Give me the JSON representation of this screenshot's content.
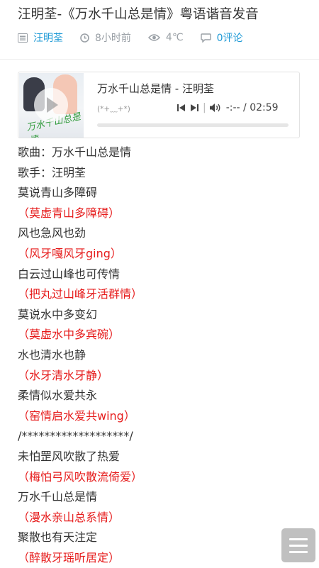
{
  "article": {
    "title": "汪明荃-《万水千山总是情》粤语谐音发音"
  },
  "meta": {
    "author": "汪明荃",
    "time": "8小时前",
    "temperature": "4℃",
    "comments": "0评论",
    "colors": {
      "link": "#1e9ad6",
      "muted": "#9aa0a6"
    }
  },
  "player": {
    "title": "万水千山总是情 - 汪明荃",
    "subtitle": "(*+﹏+*)",
    "time": "-:-- / 02:59",
    "cover_text": "万水千山总是情",
    "icons": [
      "play-icon",
      "previous-icon",
      "next-icon",
      "volume-icon"
    ]
  },
  "lyrics": [
    {
      "text": "歌曲：万水千山总是情",
      "style": "black"
    },
    {
      "text": "歌手：汪明荃",
      "style": "black"
    },
    {
      "text": "莫说青山多障碍",
      "style": "black"
    },
    {
      "text": "（莫虚青山多障碍）",
      "style": "red"
    },
    {
      "text": "风也急风也劲",
      "style": "black"
    },
    {
      "text": "（风牙嘎风牙ging）",
      "style": "red"
    },
    {
      "text": "白云过山峰也可传情",
      "style": "black"
    },
    {
      "text": "（把丸过山峰牙活群情）",
      "style": "red"
    },
    {
      "text": "莫说水中多变幻",
      "style": "black"
    },
    {
      "text": "（莫虚水中多宾碗）",
      "style": "red"
    },
    {
      "text": "水也清水也静",
      "style": "black"
    },
    {
      "text": "（水牙清水牙静）",
      "style": "red"
    },
    {
      "text": "柔情似水爱共永",
      "style": "black"
    },
    {
      "text": "（窑情启水爱共wing）",
      "style": "red"
    },
    {
      "text": "/*******************/",
      "style": "black"
    },
    {
      "text": "未怕罡风吹散了热爱",
      "style": "black"
    },
    {
      "text": "（梅怕弓风吹散流倚爱）",
      "style": "red"
    },
    {
      "text": "万水千山总是情",
      "style": "black"
    },
    {
      "text": "（漫水亲山总系情）",
      "style": "red"
    },
    {
      "text": "聚散也有天注定",
      "style": "black"
    },
    {
      "text": "（醉散牙瑶听居定）",
      "style": "red"
    }
  ],
  "ui": {
    "menu_icon": "hamburger-menu-icon",
    "accent_red": "#e61b1b"
  }
}
